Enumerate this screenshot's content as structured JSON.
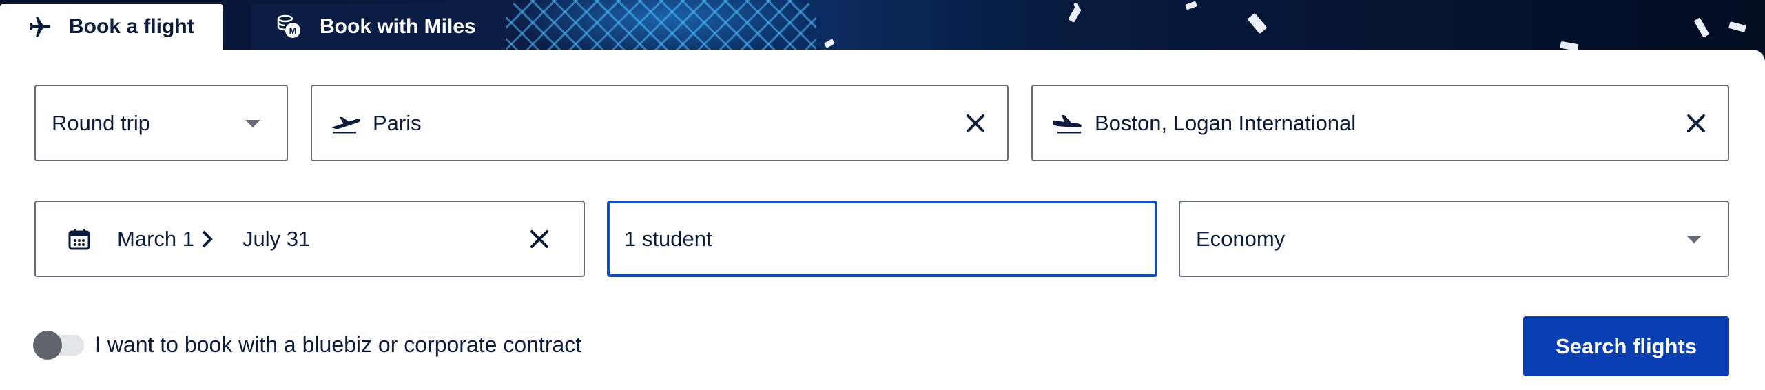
{
  "tabs": [
    {
      "label": "Book a flight",
      "icon": "airplane-icon",
      "active": true
    },
    {
      "label": "Book with Miles",
      "icon": "miles-coins-icon",
      "active": false
    }
  ],
  "form": {
    "trip_type": "Round trip",
    "origin": "Paris",
    "destination": "Boston, Logan International",
    "depart_date": "March 1",
    "return_date": "July 31",
    "passengers": "1 student",
    "cabin_class": "Economy"
  },
  "corporate_toggle": {
    "label": "I want to book with a bluebiz or corporate contract",
    "checked": false
  },
  "search_button_label": "Search flights",
  "colors": {
    "primary_button": "#0a3fb3",
    "focus_border": "#1450b5",
    "text": "#0b1b3b",
    "hero_dark": "#06122c"
  }
}
